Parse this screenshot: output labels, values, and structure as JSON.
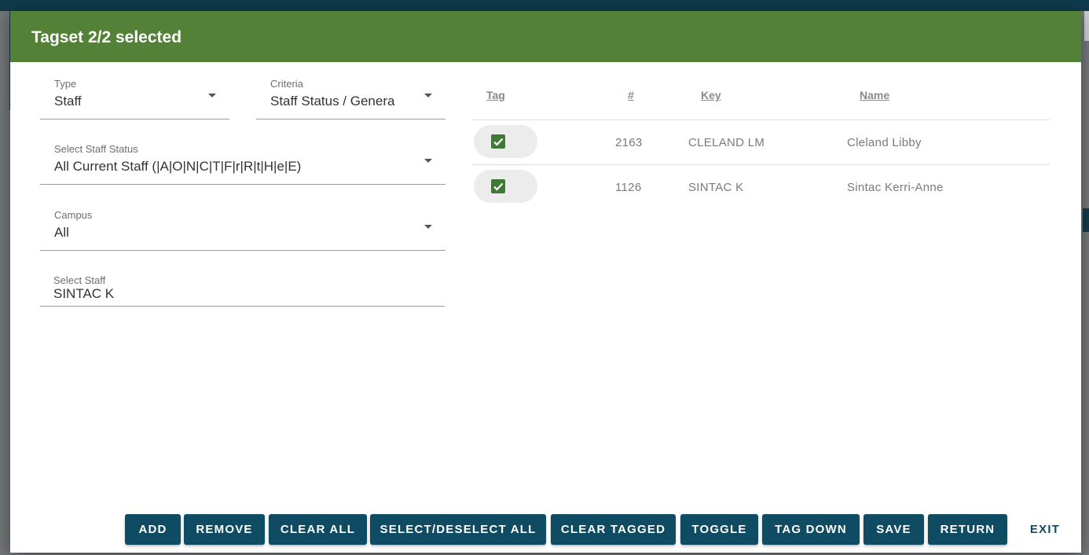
{
  "dialog": {
    "title": "Tagset 2/2 selected"
  },
  "form": {
    "type": {
      "label": "Type",
      "value": "Staff"
    },
    "criteria": {
      "label": "Criteria",
      "value": "Staff Status / Genera"
    },
    "staff_status": {
      "label": "Select Staff Status",
      "value": "All Current Staff (|A|O|N|C|T|F|r|R|t|H|e|E)"
    },
    "campus": {
      "label": "Campus",
      "value": "All"
    },
    "select_staff": {
      "label": "Select Staff",
      "value": "SINTAC K"
    }
  },
  "table": {
    "headers": {
      "tag": "Tag",
      "number": "#",
      "key": "Key",
      "name": "Name"
    },
    "rows": [
      {
        "tagged": true,
        "number": "2163",
        "key": "CLELAND LM",
        "name": "Cleland Libby"
      },
      {
        "tagged": true,
        "number": "1126",
        "key": "SINTAC K",
        "name": "Sintac Kerri-Anne"
      }
    ]
  },
  "buttons": {
    "add": "ADD",
    "remove": "REMOVE",
    "clear_all": "CLEAR ALL",
    "select_deselect_all": "SELECT/DESELECT ALL",
    "clear_tagged": "CLEAR TAGGED",
    "toggle": "TOGGLE",
    "tag_down": "TAG DOWN",
    "save": "SAVE",
    "return": "RETURN",
    "exit": "EXIT"
  },
  "colors": {
    "header_green": "#528137",
    "button_blue": "#0f4b62",
    "checkbox_green": "#3e7a35"
  }
}
